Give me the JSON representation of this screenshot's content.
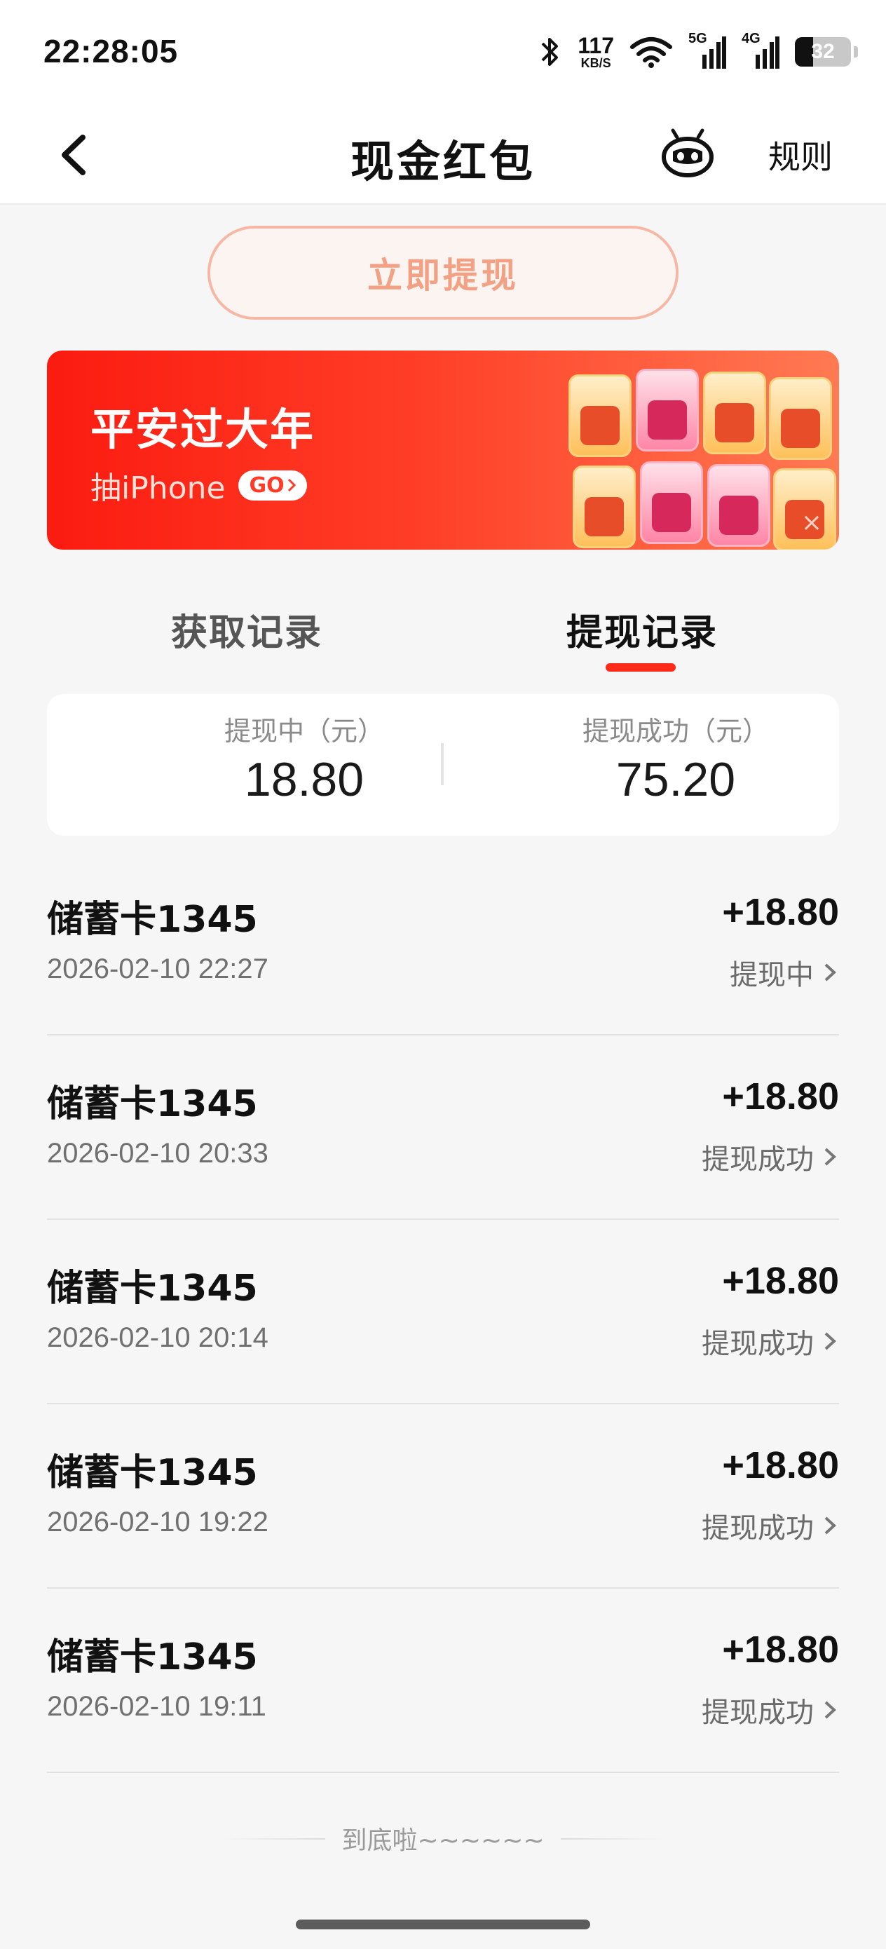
{
  "status_bar": {
    "time": "22:28:05",
    "net_speed_value": "117",
    "net_speed_unit": "KB/S",
    "signal1_label": "5G",
    "signal2_label": "4G",
    "battery": "32"
  },
  "header": {
    "title": "现金红包",
    "rules_label": "规则"
  },
  "withdraw_button_label": "立即提现",
  "banner": {
    "title": "平安过大年",
    "subtitle": "抽iPhone",
    "go_label": "GO",
    "close": "×"
  },
  "tabs": [
    {
      "label": "获取记录",
      "active": false
    },
    {
      "label": "提现记录",
      "active": true
    }
  ],
  "summary": {
    "pending_label": "提现中（元）",
    "pending_value": "18.80",
    "success_label": "提现成功（元）",
    "success_value": "75.20"
  },
  "records": [
    {
      "card": "储蓄卡1345",
      "date": "2026-02-10 22:27",
      "amount": "+18.80",
      "status": "提现中"
    },
    {
      "card": "储蓄卡1345",
      "date": "2026-02-10 20:33",
      "amount": "+18.80",
      "status": "提现成功"
    },
    {
      "card": "储蓄卡1345",
      "date": "2026-02-10 20:14",
      "amount": "+18.80",
      "status": "提现成功"
    },
    {
      "card": "储蓄卡1345",
      "date": "2026-02-10 19:22",
      "amount": "+18.80",
      "status": "提现成功"
    },
    {
      "card": "储蓄卡1345",
      "date": "2026-02-10 19:11",
      "amount": "+18.80",
      "status": "提现成功"
    }
  ],
  "footer_note": "到底啦~~~~~~",
  "colors": {
    "accent": "#ff2a1a",
    "banner_start": "#fb1b10",
    "banner_end": "#ff7a52",
    "withdraw_text": "#f3a184"
  }
}
